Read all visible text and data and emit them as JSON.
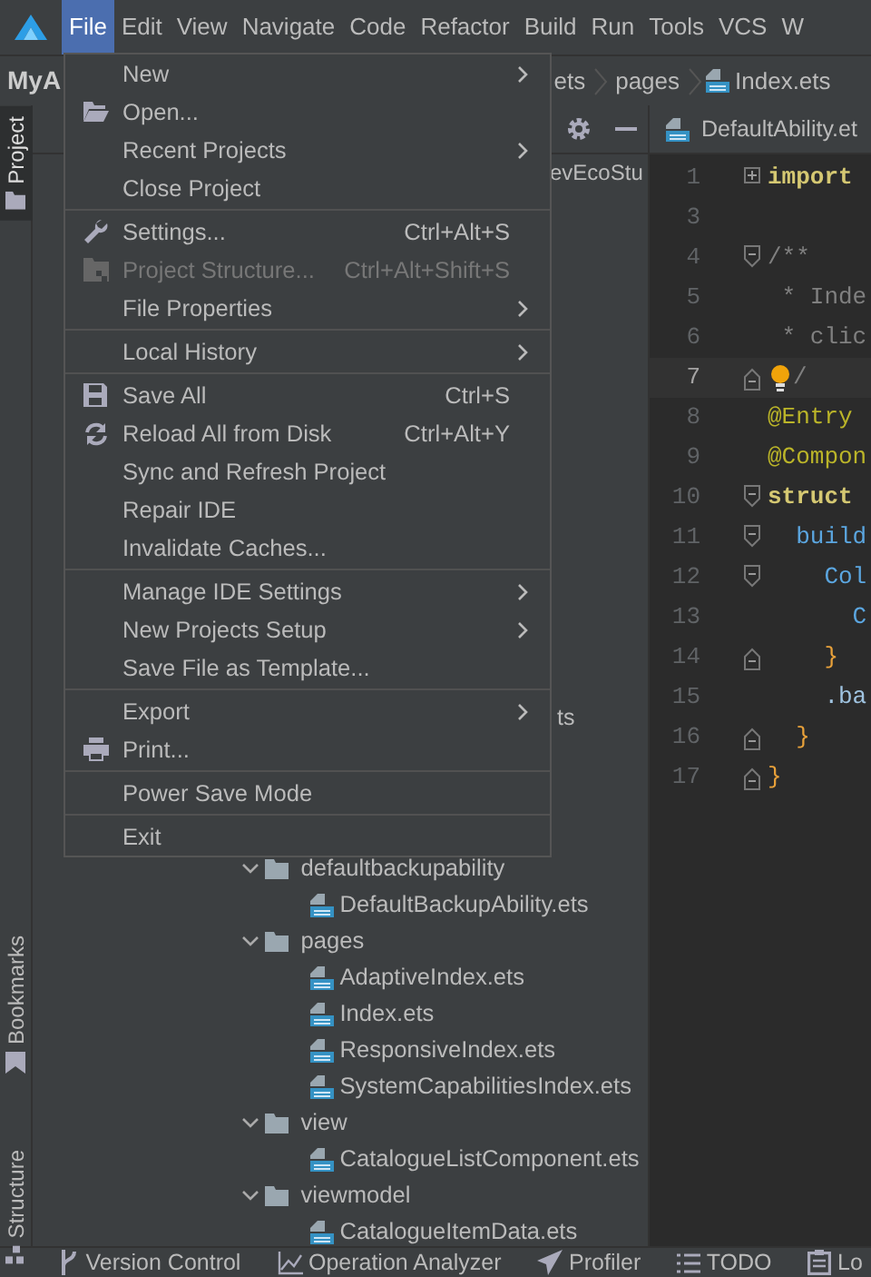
{
  "menubar": [
    {
      "label": "File",
      "selected": true
    },
    {
      "label": "Edit",
      "selected": false
    },
    {
      "label": "View",
      "selected": false
    },
    {
      "label": "Navigate",
      "selected": false
    },
    {
      "label": "Code",
      "selected": false
    },
    {
      "label": "Refactor",
      "selected": false
    },
    {
      "label": "Build",
      "selected": false
    },
    {
      "label": "Run",
      "selected": false
    },
    {
      "label": "Tools",
      "selected": false
    },
    {
      "label": "VCS",
      "selected": false
    },
    {
      "label": "W",
      "selected": false
    }
  ],
  "navbar": {
    "project": "MyA",
    "breadcrumb": [
      "ets",
      "pages",
      "Index.ets"
    ]
  },
  "side_tabs": [
    {
      "label": "Project",
      "selected": true
    },
    {
      "label": "Bookmarks",
      "selected": false
    },
    {
      "label": "Structure",
      "selected": false
    }
  ],
  "project_panel": {
    "partial_rows": [
      "evEcoStu",
      "ts"
    ],
    "tree": [
      {
        "label": "defaultbackupability",
        "expanded": true,
        "children": [
          {
            "label": "DefaultBackupAbility.ets"
          }
        ]
      },
      {
        "label": "pages",
        "expanded": true,
        "children": [
          {
            "label": "AdaptiveIndex.ets"
          },
          {
            "label": "Index.ets"
          },
          {
            "label": "ResponsiveIndex.ets"
          },
          {
            "label": "SystemCapabilitiesIndex.ets"
          }
        ]
      },
      {
        "label": "view",
        "expanded": true,
        "children": [
          {
            "label": "CatalogueListComponent.ets"
          }
        ]
      },
      {
        "label": "viewmodel",
        "expanded": true,
        "children": [
          {
            "label": "CatalogueItemData.ets"
          }
        ]
      }
    ]
  },
  "editor": {
    "tab": "DefaultAbility.et",
    "lines": [
      {
        "number": "1",
        "fold": {
          "kind": "collapsed"
        },
        "current": false,
        "tokens": [
          {
            "text": "import",
            "kind": "keyword"
          }
        ]
      },
      {
        "number": "3",
        "current": false
      },
      {
        "number": "4",
        "fold": {
          "kind": "open"
        },
        "current": false,
        "tokens": [
          {
            "text": "/**",
            "kind": "comment"
          }
        ]
      },
      {
        "number": "5",
        "current": false,
        "tokens": [
          {
            "text": " * Inde",
            "kind": "comment"
          }
        ]
      },
      {
        "number": "6",
        "current": false,
        "tokens": [
          {
            "text": " * clic",
            "kind": "comment"
          }
        ]
      },
      {
        "number": "7",
        "fold": {
          "kind": "close"
        },
        "current": true,
        "bulb": true,
        "tokens": [
          {
            "text": "/",
            "kind": "comment"
          }
        ]
      },
      {
        "number": "8",
        "current": false,
        "tokens": [
          {
            "text": "@Entry",
            "kind": "decorator"
          }
        ]
      },
      {
        "number": "9",
        "current": false,
        "tokens": [
          {
            "text": "@Compon",
            "kind": "decorator"
          }
        ]
      },
      {
        "number": "10",
        "fold": {
          "kind": "open"
        },
        "current": false,
        "tokens": [
          {
            "text": "struct",
            "kind": "keyword"
          }
        ]
      },
      {
        "number": "11",
        "fold": {
          "kind": "open"
        },
        "current": false,
        "tokens": [
          {
            "text": "  build",
            "kind": "function"
          }
        ]
      },
      {
        "number": "12",
        "fold": {
          "kind": "open"
        },
        "current": false,
        "tokens": [
          {
            "text": "    Col",
            "kind": "function"
          }
        ]
      },
      {
        "number": "13",
        "current": false,
        "tokens": [
          {
            "text": "      C",
            "kind": "function"
          }
        ]
      },
      {
        "number": "14",
        "fold": {
          "kind": "close"
        },
        "current": false,
        "tokens": [
          {
            "text": "    }",
            "kind": "brace"
          }
        ]
      },
      {
        "number": "15",
        "current": false,
        "tokens": [
          {
            "text": "    .ba",
            "kind": "method"
          }
        ]
      },
      {
        "number": "16",
        "fold": {
          "kind": "close"
        },
        "current": false,
        "tokens": [
          {
            "text": "  }",
            "kind": "brace"
          }
        ]
      },
      {
        "number": "17",
        "fold": {
          "kind": "close"
        },
        "current": false,
        "tokens": [
          {
            "text": "}",
            "kind": "brace"
          }
        ]
      }
    ]
  },
  "file_menu": [
    {
      "kind": "item",
      "label": "New",
      "submenu": true,
      "disabled": false
    },
    {
      "kind": "open",
      "label": "Open...",
      "disabled": false
    },
    {
      "kind": "item",
      "label": "Recent Projects",
      "submenu": true,
      "disabled": false
    },
    {
      "kind": "item",
      "label": "Close Project",
      "disabled": false
    },
    {
      "kind": "separator"
    },
    {
      "kind": "settings",
      "label": "Settings...",
      "shortcut": "Ctrl+Alt+S",
      "disabled": false
    },
    {
      "kind": "structure",
      "label": "Project Structure...",
      "shortcut": "Ctrl+Alt+Shift+S",
      "disabled": true
    },
    {
      "kind": "item",
      "label": "File Properties",
      "submenu": true,
      "disabled": false
    },
    {
      "kind": "separator"
    },
    {
      "kind": "item",
      "label": "Local History",
      "submenu": true,
      "disabled": false
    },
    {
      "kind": "separator"
    },
    {
      "kind": "save",
      "label": "Save All",
      "shortcut": "Ctrl+S",
      "disabled": false
    },
    {
      "kind": "reload",
      "label": "Reload All from Disk",
      "shortcut": "Ctrl+Alt+Y",
      "disabled": false
    },
    {
      "kind": "item",
      "label": "Sync and Refresh Project",
      "disabled": false
    },
    {
      "kind": "item",
      "label": "Repair IDE",
      "disabled": false
    },
    {
      "kind": "item",
      "label": "Invalidate Caches...",
      "disabled": false
    },
    {
      "kind": "separator"
    },
    {
      "kind": "item",
      "label": "Manage IDE Settings",
      "submenu": true,
      "disabled": false
    },
    {
      "kind": "item",
      "label": "New Projects Setup",
      "submenu": true,
      "disabled": false
    },
    {
      "kind": "item",
      "label": "Save File as Template...",
      "disabled": false
    },
    {
      "kind": "separator"
    },
    {
      "kind": "item",
      "label": "Export",
      "submenu": true,
      "disabled": false
    },
    {
      "kind": "print",
      "label": "Print...",
      "disabled": false
    },
    {
      "kind": "separator"
    },
    {
      "kind": "item",
      "label": "Power Save Mode",
      "disabled": false
    },
    {
      "kind": "separator"
    },
    {
      "kind": "item",
      "label": "Exit",
      "disabled": false
    }
  ],
  "status_bar": [
    {
      "label": "Version Control"
    },
    {
      "label": "Operation Analyzer"
    },
    {
      "label": "Profiler"
    },
    {
      "label": "TODO"
    },
    {
      "label": "Lo"
    }
  ]
}
